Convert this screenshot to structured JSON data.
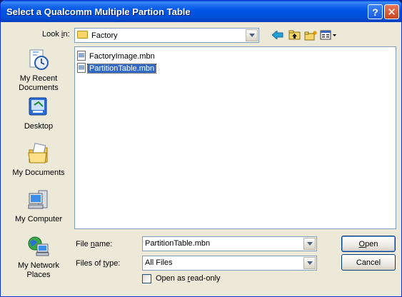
{
  "window": {
    "title": "Select a Qualcomm Multiple Partion Table",
    "help_glyph": "?",
    "close_glyph": "✕"
  },
  "toolbar": {
    "look_in_label_prefix": "Look ",
    "look_in_label_accel": "i",
    "look_in_label_suffix": "n:",
    "look_in_value": "Factory"
  },
  "places": [
    {
      "line1": "My Recent",
      "line2": "Documents"
    },
    {
      "line1": "Desktop",
      "line2": ""
    },
    {
      "line1": "My Documents",
      "line2": ""
    },
    {
      "line1": "My Computer",
      "line2": ""
    },
    {
      "line1": "My Network",
      "line2": "Places"
    }
  ],
  "files": [
    {
      "name": "FactoryImage.mbn",
      "selected": false
    },
    {
      "name": "PartitionTable.mbn",
      "selected": true
    }
  ],
  "form": {
    "file_name_label_prefix": "File ",
    "file_name_label_accel": "n",
    "file_name_label_suffix": "ame:",
    "file_name_value": "PartitionTable.mbn",
    "files_of_type_label_prefix": "Files of ",
    "files_of_type_label_accel": "t",
    "files_of_type_label_suffix": "ype:",
    "files_of_type_value": "All Files",
    "readonly_label_prefix": "Open as ",
    "readonly_label_accel": "r",
    "readonly_label_suffix": "ead-only",
    "readonly_checked": false
  },
  "buttons": {
    "open_accel": "O",
    "open_rest": "pen",
    "cancel": "Cancel"
  },
  "colors": {
    "title_bar": "#0055e5",
    "selection": "#316ac5",
    "dialog_face": "#ece9d8"
  }
}
